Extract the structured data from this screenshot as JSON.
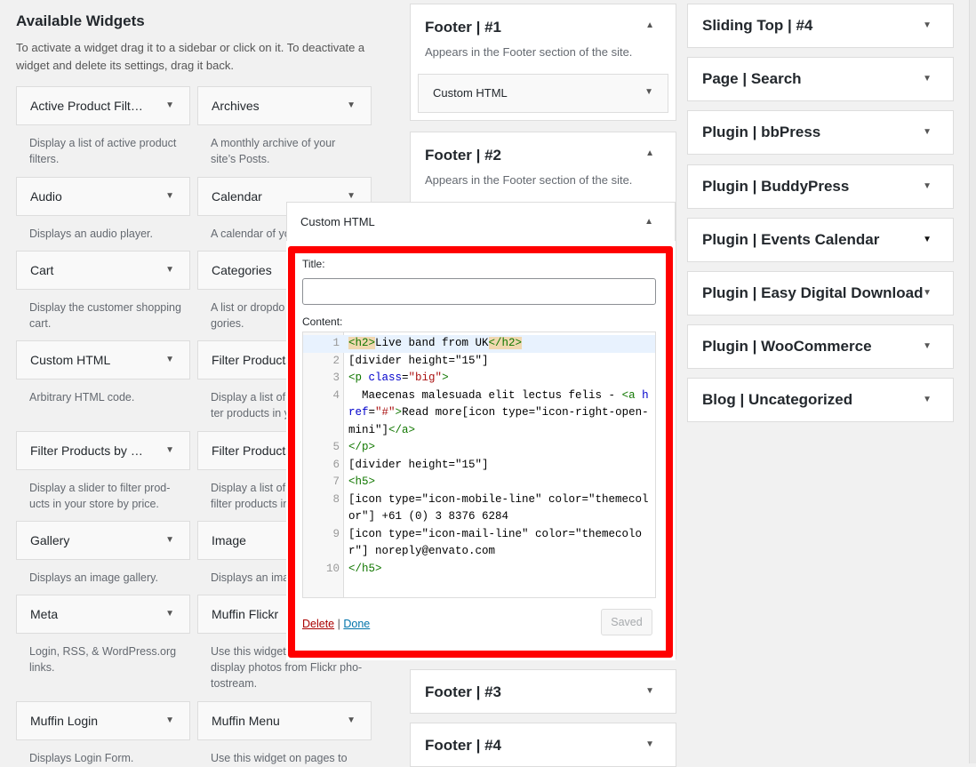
{
  "available": {
    "title": "Available Widgets",
    "description": "To activate a widget drag it to a sidebar or click on it. To deactivate a widget and delete its settings, drag it back.",
    "widgets_col1": [
      {
        "title": "Active Product Filt…",
        "desc": "Display a list of active product\nfilters."
      },
      {
        "title": "Audio",
        "desc": "Displays an audio player."
      },
      {
        "title": "Cart",
        "desc": "Display the customer shopping\ncart."
      },
      {
        "title": "Custom HTML",
        "desc": "Arbitrary HTML code."
      },
      {
        "title": "Filter Products by …",
        "desc": "Display a slider to filter prod-\nucts in your store by price."
      },
      {
        "title": "Gallery",
        "desc": "Displays an image gallery."
      },
      {
        "title": "Meta",
        "desc": "Login, RSS, & WordPress.org\nlinks."
      },
      {
        "title": "Muffin Login",
        "desc": "Displays Login Form."
      }
    ],
    "widgets_col2": [
      {
        "title": "Archives",
        "desc": "A monthly archive of your\nsite’s Posts."
      },
      {
        "title": "Calendar",
        "desc": "A calendar of yo"
      },
      {
        "title": "Categories",
        "desc": "A list or dropdo\ngories."
      },
      {
        "title": "Filter Products",
        "desc": "Display a list of a\nter products in y"
      },
      {
        "title": "Filter Products",
        "desc": "Display a list of s\nfilter products in"
      },
      {
        "title": "Image",
        "desc": "Displays an imag"
      },
      {
        "title": "Muffin Flickr",
        "desc": "Use this widget o\ndisplay photos from Flickr pho-\ntostream."
      },
      {
        "title": "Muffin Menu",
        "desc": "Use this widget on pages to"
      }
    ]
  },
  "sidebars_mid": {
    "footer1": {
      "title": "Footer | #1",
      "desc": "Appears in the Footer section of the site.",
      "widget": "Custom HTML"
    },
    "footer2": {
      "title": "Footer | #2",
      "desc": "Appears in the Footer section of the site."
    },
    "footer3": {
      "title": "Footer | #3"
    },
    "footer4": {
      "title": "Footer | #4"
    }
  },
  "sidebars_right": [
    "Sliding Top | #4",
    "Page | Search",
    "Plugin | bbPress",
    "Plugin | BuddyPress",
    "Plugin | Events Calendar",
    "Plugin | Easy Digital Download",
    "Plugin | WooCommerce",
    "Blog | Uncategorized"
  ],
  "editor_widget": {
    "header": "Custom HTML",
    "title_label": "Title:",
    "title_value": "",
    "content_label": "Content:",
    "code_lines": [
      [
        {
          "t": "<h2>",
          "c": "tag hl"
        },
        {
          "t": "Live band from UK",
          "c": ""
        },
        {
          "t": "</h2>",
          "c": "tag hl"
        }
      ],
      [
        {
          "t": "[divider height=\"15\"]",
          "c": ""
        }
      ],
      [
        {
          "t": "<p ",
          "c": "tag"
        },
        {
          "t": "class",
          "c": "attr"
        },
        {
          "t": "=",
          "c": ""
        },
        {
          "t": "\"big\"",
          "c": "str"
        },
        {
          "t": ">",
          "c": "tag"
        }
      ],
      [
        {
          "t": "  Maecenas malesuada elit lectus felis - ",
          "c": ""
        },
        {
          "t": "<a ",
          "c": "tag"
        },
        {
          "t": "href",
          "c": "attr"
        },
        {
          "t": "=",
          "c": ""
        },
        {
          "t": "\"#\"",
          "c": "str"
        },
        {
          "t": ">",
          "c": "tag"
        },
        {
          "t": "Read more[icon type=\"icon-right-open-mini\"]",
          "c": ""
        },
        {
          "t": "</a>",
          "c": "tag"
        }
      ],
      [
        {
          "t": "</p>",
          "c": "tag"
        }
      ],
      [
        {
          "t": "[divider height=\"15\"]",
          "c": ""
        }
      ],
      [
        {
          "t": "<h5>",
          "c": "tag"
        }
      ],
      [
        {
          "t": "[icon type=\"icon-mobile-line\" color=\"themecolor\"] +61 (0) 3 8376 6284",
          "c": ""
        }
      ],
      [
        {
          "t": "[icon type=\"icon-mail-line\" color=\"themecolor\"] noreply@envato.com",
          "c": ""
        }
      ],
      [
        {
          "t": "</h5>",
          "c": "tag"
        }
      ]
    ],
    "delete_label": "Delete",
    "separator": "|",
    "done_label": "Done",
    "saved_label": "Saved"
  },
  "colors": {
    "highlight_border": "#ff0000",
    "background": "#f1f1f1"
  }
}
